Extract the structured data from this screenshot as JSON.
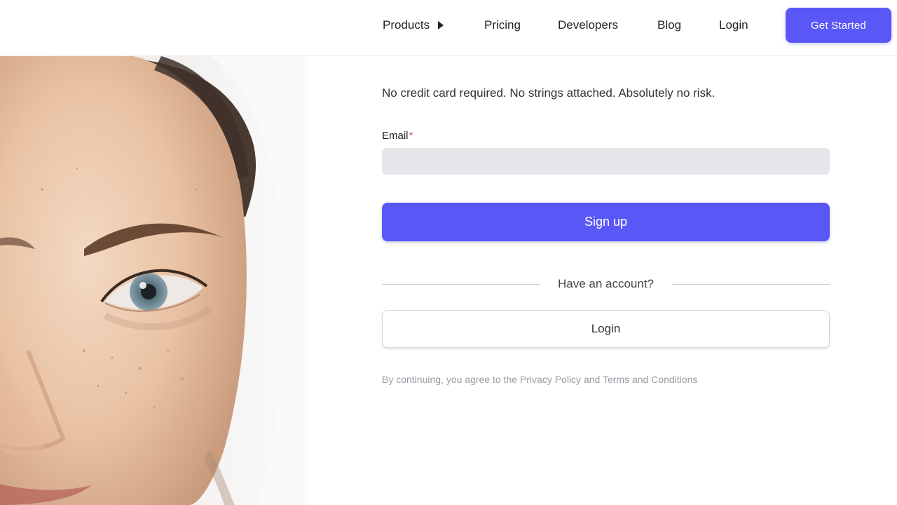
{
  "nav": {
    "products_label": "Products",
    "pricing_label": "Pricing",
    "developers_label": "Developers",
    "blog_label": "Blog",
    "login_label": "Login",
    "get_started_label": "Get Started"
  },
  "hero": {
    "image_alt": "Close-up portrait of a person with a headscarf"
  },
  "form": {
    "tagline": "No credit card required. No strings attached. Absolutely no risk.",
    "email_label": "Email",
    "required_mark": "*",
    "email_value": "",
    "signup_label": "Sign up",
    "have_account_text": "Have an account?",
    "login_label": "Login"
  },
  "legal": {
    "prefix": "By continuing, you agree to the ",
    "privacy_label": "Privacy Policy",
    "and_text": " and ",
    "terms_label": "Terms and Conditions"
  },
  "colors": {
    "accent": "#5a57f7",
    "input_bg": "#e6e7ea",
    "muted_text": "#9a9aa4"
  },
  "icons": {
    "products_caret": "caret-right-icon"
  }
}
